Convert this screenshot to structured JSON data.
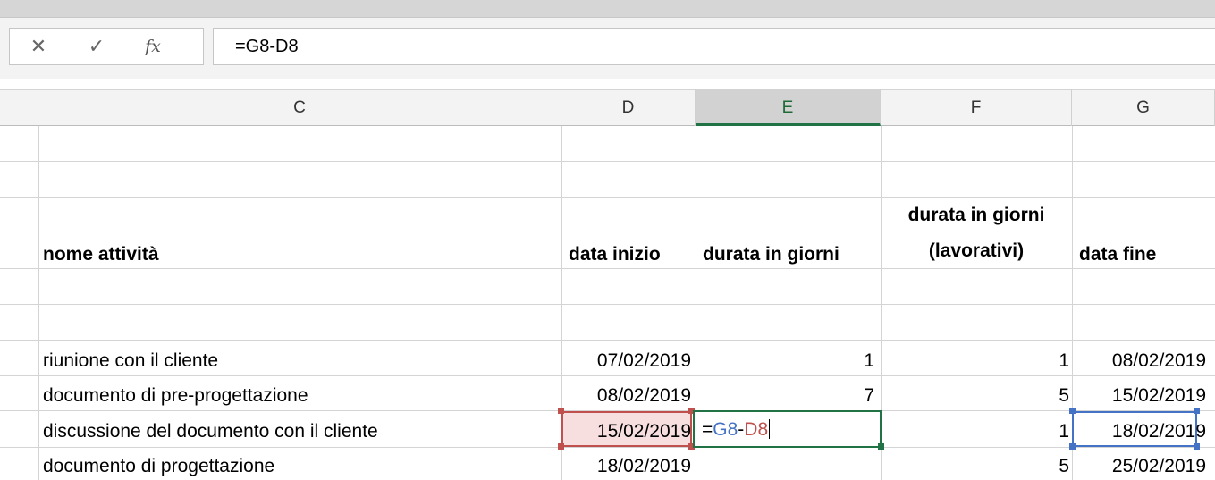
{
  "formula_bar": {
    "cancel_icon": "✕",
    "enter_icon": "✓",
    "fx_icon": "fx",
    "formula": "=G8-D8"
  },
  "columns": [
    "C",
    "D",
    "E",
    "F",
    "G"
  ],
  "selected_column": "E",
  "headers": {
    "c": "nome attività",
    "d": "data inizio",
    "e": "durata in giorni",
    "f_line1": "durata in giorni",
    "f_line2": "(lavorativi)",
    "g": "data fine"
  },
  "rows": [
    {
      "name": "riunione con il cliente",
      "start": "07/02/2019",
      "duration": "1",
      "workdays": "1",
      "end": "08/02/2019"
    },
    {
      "name": "documento di pre-progettazione",
      "start": "08/02/2019",
      "duration": "7",
      "workdays": "5",
      "end": "15/02/2019"
    },
    {
      "name": "discussione del documento con il cliente",
      "start": "15/02/2019",
      "duration": "",
      "workdays": "1",
      "end": "18/02/2019"
    },
    {
      "name": "documento di progettazione",
      "start": "18/02/2019",
      "duration": "",
      "workdays": "5",
      "end": "25/02/2019"
    }
  ],
  "edit_cell": {
    "eq": "=",
    "ref1": "G8",
    "op": "-",
    "ref2": "D8"
  },
  "colors": {
    "ref_blue": "#4472c4",
    "ref_red": "#c0504d",
    "select_green": "#217346"
  }
}
